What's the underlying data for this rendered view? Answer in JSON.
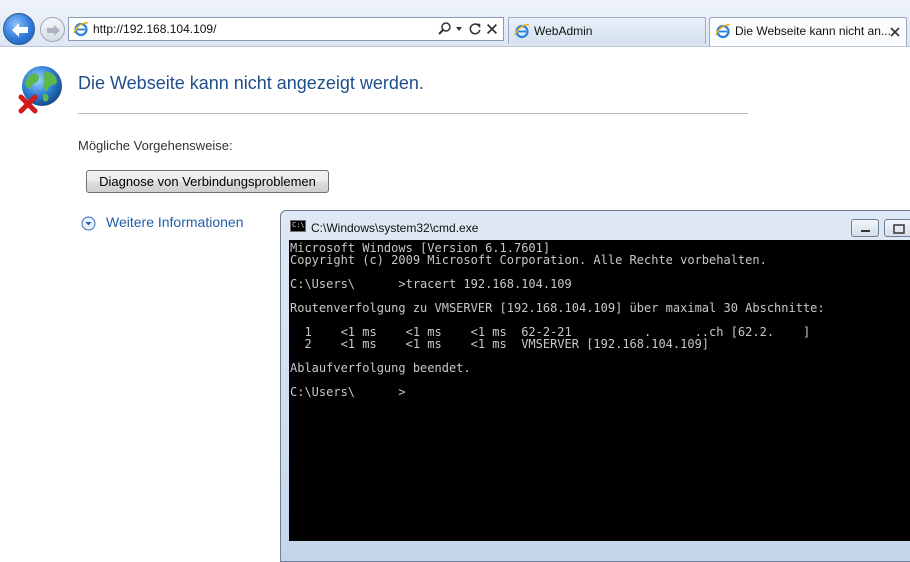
{
  "browser": {
    "address_url": "http://192.168.104.109/",
    "tabs": [
      {
        "label": "WebAdmin",
        "active": false
      },
      {
        "label": "Die Webseite kann nicht an...",
        "active": true
      }
    ]
  },
  "error_page": {
    "title": "Die Webseite kann nicht angezeigt werden.",
    "options_label": "Mögliche Vorgehensweise:",
    "diagnose_button": "Diagnose von Verbindungsproblemen",
    "more_info_link": "Weitere Informationen"
  },
  "cmd": {
    "title": "C:\\Windows\\system32\\cmd.exe",
    "icon_text": "C:\\",
    "lines": [
      "Microsoft Windows [Version 6.1.7601]",
      "Copyright (c) 2009 Microsoft Corporation. Alle Rechte vorbehalten.",
      "",
      "C:\\Users\\      >tracert 192.168.104.109",
      "",
      "Routenverfolgung zu VMSERVER [192.168.104.109] über maximal 30 Abschnitte:",
      "",
      "  1    <1 ms    <1 ms    <1 ms  62-2-21          .      ..ch [62.2.    ]",
      "  2    <1 ms    <1 ms    <1 ms  VMSERVER [192.168.104.109]",
      "",
      "Ablaufverfolgung beendet.",
      "",
      "C:\\Users\\      >"
    ]
  },
  "colors": {
    "title_blue": "#1f4e8c",
    "link_blue": "#1f5fa8",
    "console_bg": "#000000",
    "console_fg": "#c8c8c8"
  },
  "icons": [
    "back-arrow-icon",
    "forward-arrow-icon",
    "ie-logo-icon",
    "search-icon",
    "dropdown-arrow-icon",
    "refresh-icon",
    "stop-icon",
    "tab-close-icon",
    "globe-error-icon",
    "expand-chevron-icon",
    "console-icon",
    "minimize-icon",
    "maximize-icon"
  ]
}
